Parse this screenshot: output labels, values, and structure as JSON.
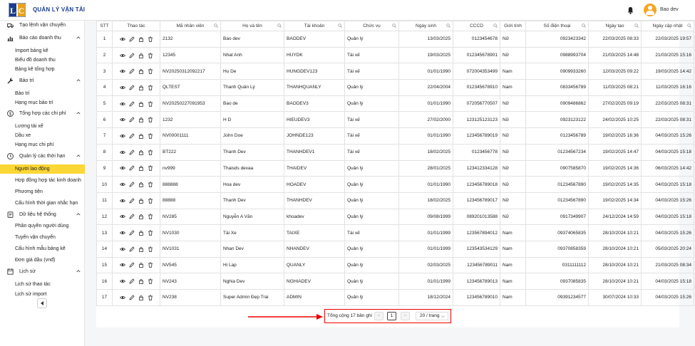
{
  "app": {
    "title": "QUẢN LÝ VẬN TẢI",
    "user_name": "Bao dev"
  },
  "colors": {
    "accent": "#fcd735",
    "brand": "#1a3c8c",
    "highlight": "#e00000"
  },
  "sidebar": {
    "rows": [
      {
        "type": "group",
        "label": "Tạo lệnh vận chuyển",
        "icon": "truck-icon",
        "chevron": false
      },
      {
        "type": "group",
        "label": "Báo cáo doanh thu",
        "icon": "bar-chart-icon",
        "chevron": true
      },
      {
        "type": "item",
        "label": "Import bảng kê"
      },
      {
        "type": "item",
        "label": "Biểu đồ doanh thu"
      },
      {
        "type": "item",
        "label": "Bảng kê tổng hợp"
      },
      {
        "type": "group",
        "label": "Bảo trì",
        "icon": "wrench-icon",
        "chevron": true
      },
      {
        "type": "item",
        "label": "Bảo trì"
      },
      {
        "type": "item",
        "label": "Hạng mục bảo trì"
      },
      {
        "type": "group",
        "label": "Tổng hợp các chi phí",
        "icon": "dollar-icon",
        "chevron": true
      },
      {
        "type": "item",
        "label": "Lương tài xế"
      },
      {
        "type": "item",
        "label": "Dầu xe"
      },
      {
        "type": "item",
        "label": "Hạng mục chi phí"
      },
      {
        "type": "group",
        "label": "Quản lý các thời hạn",
        "icon": "clock-icon",
        "chevron": true
      },
      {
        "type": "item",
        "label": "Người lao động",
        "active": true
      },
      {
        "type": "item",
        "label": "Hợp đồng hợp tác kinh doanh"
      },
      {
        "type": "item",
        "label": "Phương tiện"
      },
      {
        "type": "item",
        "label": "Cấu hình thời gian nhắc hạn"
      },
      {
        "type": "group",
        "label": "Dữ liệu hệ thống",
        "icon": "database-icon",
        "chevron": true
      },
      {
        "type": "item",
        "label": "Phân quyền người dùng"
      },
      {
        "type": "item",
        "label": "Tuyến vận chuyển"
      },
      {
        "type": "item",
        "label": "Cấu hình mẫu bảng kê"
      },
      {
        "type": "item",
        "label": "Đơn giá dầu (vnđ)"
      },
      {
        "type": "group",
        "label": "Lịch sử",
        "icon": "history-icon",
        "chevron": true
      },
      {
        "type": "item",
        "label": "Lịch sử thao tác"
      },
      {
        "type": "item",
        "label": "Lịch sử import"
      }
    ]
  },
  "table": {
    "headers": [
      "STT",
      "Thao tác",
      "Mã nhân viên",
      "Họ và tên",
      "Tài khoản",
      "Chức vụ",
      "Ngày sinh",
      "CCCD",
      "Giới tính",
      "Số điện thoại",
      "Ngày tạo",
      "Ngày cập nhật"
    ],
    "searchable": [
      false,
      false,
      true,
      true,
      true,
      true,
      true,
      true,
      false,
      true,
      true,
      true
    ],
    "rows": [
      [
        "1",
        "2132",
        "Bao dev",
        "BAODEV",
        "Quản lý",
        "13/03/2025",
        "0123454678",
        "Nữ",
        "0923423342",
        "22/03/2025 08:33",
        "22/03/2025 19:57"
      ],
      [
        "2",
        "12345",
        "Nhat Anh",
        "HUYDK",
        "Tài xế",
        "19/03/2025",
        "012345678901",
        "Nữ",
        "0988993704",
        "21/03/2025 14:48",
        "21/03/2025 15:16"
      ],
      [
        "3",
        "NV20250312092217",
        "Hu De",
        "HUNGDEV123",
        "Tài xế",
        "01/01/1990",
        "072004353499",
        "Nam",
        "0909933260",
        "12/03/2025 09:22",
        "19/03/2025 14:42"
      ],
      [
        "4",
        "QLTEST",
        "Thanh Quản Lý",
        "THANHQUANLY",
        "Quản lý",
        "22/04/2004",
        "0123456789​10",
        "Nam",
        "0833456789",
        "11/03/2025 08:21",
        "11/03/2025 16:16"
      ],
      [
        "5",
        "NV20250227091953",
        "Bao de",
        "BAODEV3",
        "Quản lý",
        "01/01/1990",
        "072056770507",
        "Nữ",
        "0909486862",
        "27/02/2025 09:19",
        "22/03/2025 08:31"
      ],
      [
        "6",
        "1232",
        "H D",
        "HIEUDEV3",
        "Tài xế",
        "27/02/2000",
        "123125123123",
        "Nữ",
        "0923123122",
        "24/02/2025 10:25",
        "22/03/2025 08:31"
      ],
      [
        "7",
        "NV00001111",
        "John Doe",
        "JOHNDE123",
        "Tài xế",
        "01/01/1990",
        "123456789019",
        "Nữ",
        "0123456789",
        "19/02/2025 16:36",
        "04/03/2025 15:26"
      ],
      [
        "8",
        "BT222",
        "Thanh Dev",
        "THANHDEV1",
        "Tài xế",
        "18/02/2025",
        "0123456778",
        "Nữ",
        "01234567234",
        "19/02/2025 14:47",
        "04/03/2025 15:18"
      ],
      [
        "9",
        "nv999",
        "Thaisds devaa",
        "THAIDEV",
        "Quản lý",
        "28/01/2025",
        "123412334128",
        "Nữ",
        "0907585870",
        "19/02/2025 14:36",
        "06/03/2025 14:42"
      ],
      [
        "10",
        "888888",
        "Hoa dev",
        "HOADEV",
        "Quản lý",
        "01/01/1990",
        "123456789018",
        "Nữ",
        "01234567890",
        "19/02/2025 14:35",
        "04/03/2025 15:18"
      ],
      [
        "11",
        "88888",
        "Thanh Dev",
        "THANHDEV",
        "Quản lý",
        "18/02/2025",
        "123456789017",
        "Nữ",
        "01234567890",
        "19/02/2025 14:34",
        "04/03/2025 15:26"
      ],
      [
        "12",
        "NV285",
        "Nguyễn A Văn",
        "khoadev",
        "Quản lý",
        "09/08/1999",
        "089201013588",
        "Nữ",
        "0917349907",
        "24/12/2024 14:59",
        "04/03/2025 15:18"
      ],
      [
        "13",
        "NV1030",
        "Tài Xe",
        "TAIXE",
        "Tài xế",
        "01/01/1999",
        "123567894012",
        "Nam",
        "09374065835",
        "28/10/2024 10:21",
        "04/03/2025 15:26"
      ],
      [
        "14",
        "NV1031",
        "Nhan Dev",
        "NHANDEV",
        "Quản lý",
        "01/01/1999",
        "123543534129",
        "Nam",
        "09370858359",
        "28/10/2024 10:21",
        "05/03/2025 20:24"
      ],
      [
        "15",
        "NV545",
        "Hi Lap",
        "QUANLY",
        "Quản lý",
        "02/03/2025",
        "123456789011",
        "Nam",
        "0311111112",
        "28/10/2024 10:21",
        "21/03/2025 08:34"
      ],
      [
        "16",
        "NV243",
        "Nghia Dev",
        "NGHIADEV",
        "Quản lý",
        "01/01/1999",
        "123456789013",
        "Nam",
        "09370858​35",
        "28/10/2024 10:21",
        "04/03/2025 15:18"
      ],
      [
        "17",
        "NV238",
        "Super Admin Đẹp Trai",
        "ADMIN",
        "Quản lý",
        "18/12/2024",
        "123456789010",
        "Nam",
        "09391234577",
        "30/07/2024 10:33",
        "04/03/2025 15:26"
      ]
    ]
  },
  "pagination": {
    "total_text": "Tổng cộng 17 bản ghi",
    "prev_label": "<",
    "current_page": "1",
    "next_label": ">",
    "page_size": "20 / trang"
  }
}
